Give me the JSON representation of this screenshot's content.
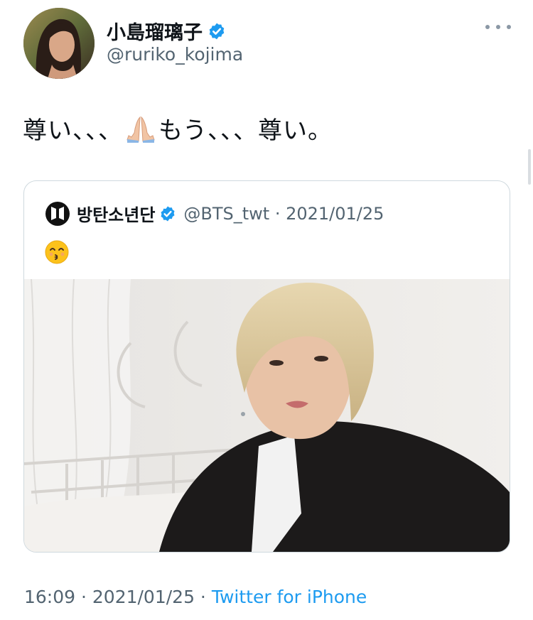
{
  "author": {
    "display_name": "小島瑠璃子",
    "handle": "@ruriko_kojima",
    "verified": true
  },
  "tweet": {
    "text_part1": "尊い、、、",
    "emoji": "folded-hands",
    "text_part2": "もう、、、尊い。"
  },
  "quoted_tweet": {
    "display_name": "방탄소년단",
    "verified": true,
    "handle_date": "@BTS_twt · 2021/01/25",
    "emoji": "kissing-face-with-smiling-eyes",
    "avatar_logo_text": "BTS"
  },
  "meta": {
    "time_date": "16:09 · 2021/01/25 · ",
    "source": "Twitter for iPhone"
  },
  "colors": {
    "verified_blue": "#1d9bf0",
    "secondary_text": "#536471",
    "border": "#cfd9de"
  }
}
